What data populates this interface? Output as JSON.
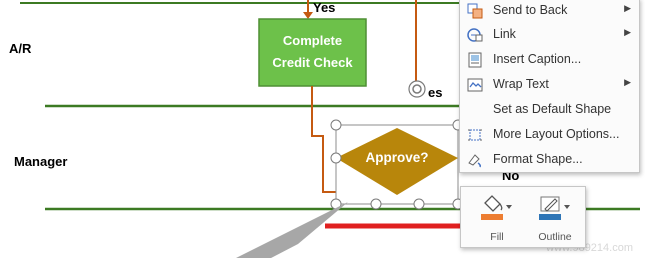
{
  "diagram": {
    "lanes": [
      {
        "label": "A/R"
      },
      {
        "label": "Manager"
      }
    ],
    "process_box": {
      "line1": "Complete",
      "line2": "Credit Check"
    },
    "decision": {
      "label": "Approve?"
    },
    "yes_top": "Yes",
    "yes_mid": "es",
    "no_label": "No",
    "colors": {
      "lane_line": "#3c7a23",
      "process_fill": "#6dc14a",
      "decision_fill": "#b8860b",
      "connector": "#c55a11",
      "arrow": "#e02020"
    }
  },
  "context_menu": {
    "items": [
      {
        "label": "Send to Back",
        "icon": "send-to-back-icon",
        "submenu": true
      },
      {
        "label": "Link",
        "icon": "link-icon",
        "submenu": true
      },
      {
        "label": "Insert Caption...",
        "icon": "insert-caption-icon",
        "submenu": false
      },
      {
        "label": "Wrap Text",
        "icon": "wrap-text-icon",
        "submenu": true
      },
      {
        "label": "Set as Default Shape",
        "icon": "",
        "submenu": false
      },
      {
        "label": "More Layout Options...",
        "icon": "layout-options-icon",
        "submenu": false
      },
      {
        "label": "Format Shape...",
        "icon": "format-shape-icon",
        "submenu": false
      }
    ]
  },
  "mini_toolbar": {
    "fill_label": "Fill",
    "outline_label": "Outline"
  },
  "watermark": "www.989214.com"
}
